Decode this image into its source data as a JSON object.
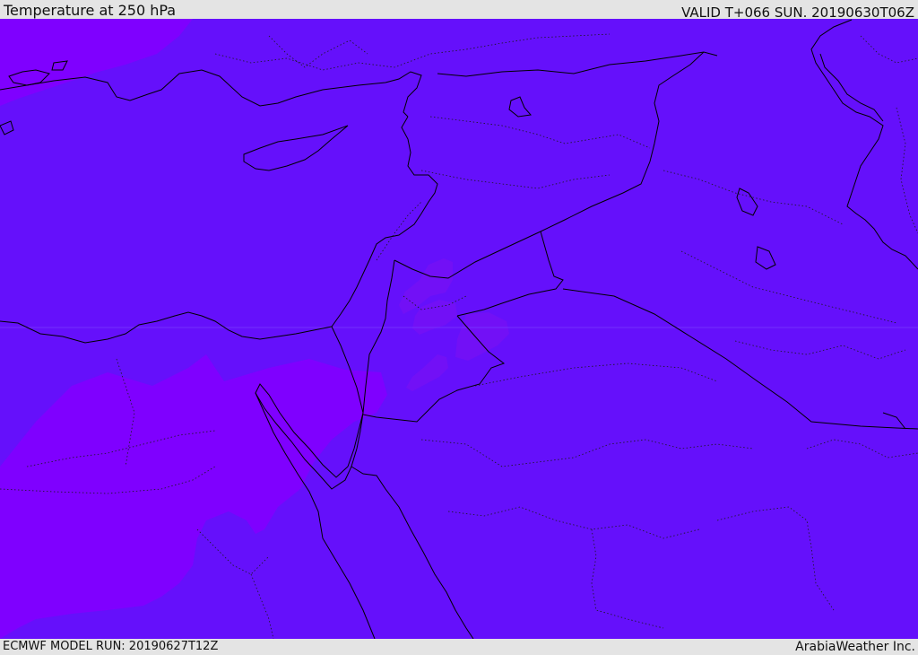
{
  "header": {
    "title": "Temperature at 250 hPa",
    "valid": "VALID T+066 SUN. 20190630T06Z"
  },
  "footer": {
    "model_run": "ECMWF MODEL RUN: 20190627T12Z",
    "credit": "ArabiaWeather Inc."
  },
  "map": {
    "field": "temperature",
    "level": "250 hPa",
    "colors": {
      "background": "#6510fb",
      "warmer_shade": "#7f00ff",
      "patch_shade": "#7210f6",
      "coastline": "#000000",
      "border": "#000000"
    }
  }
}
